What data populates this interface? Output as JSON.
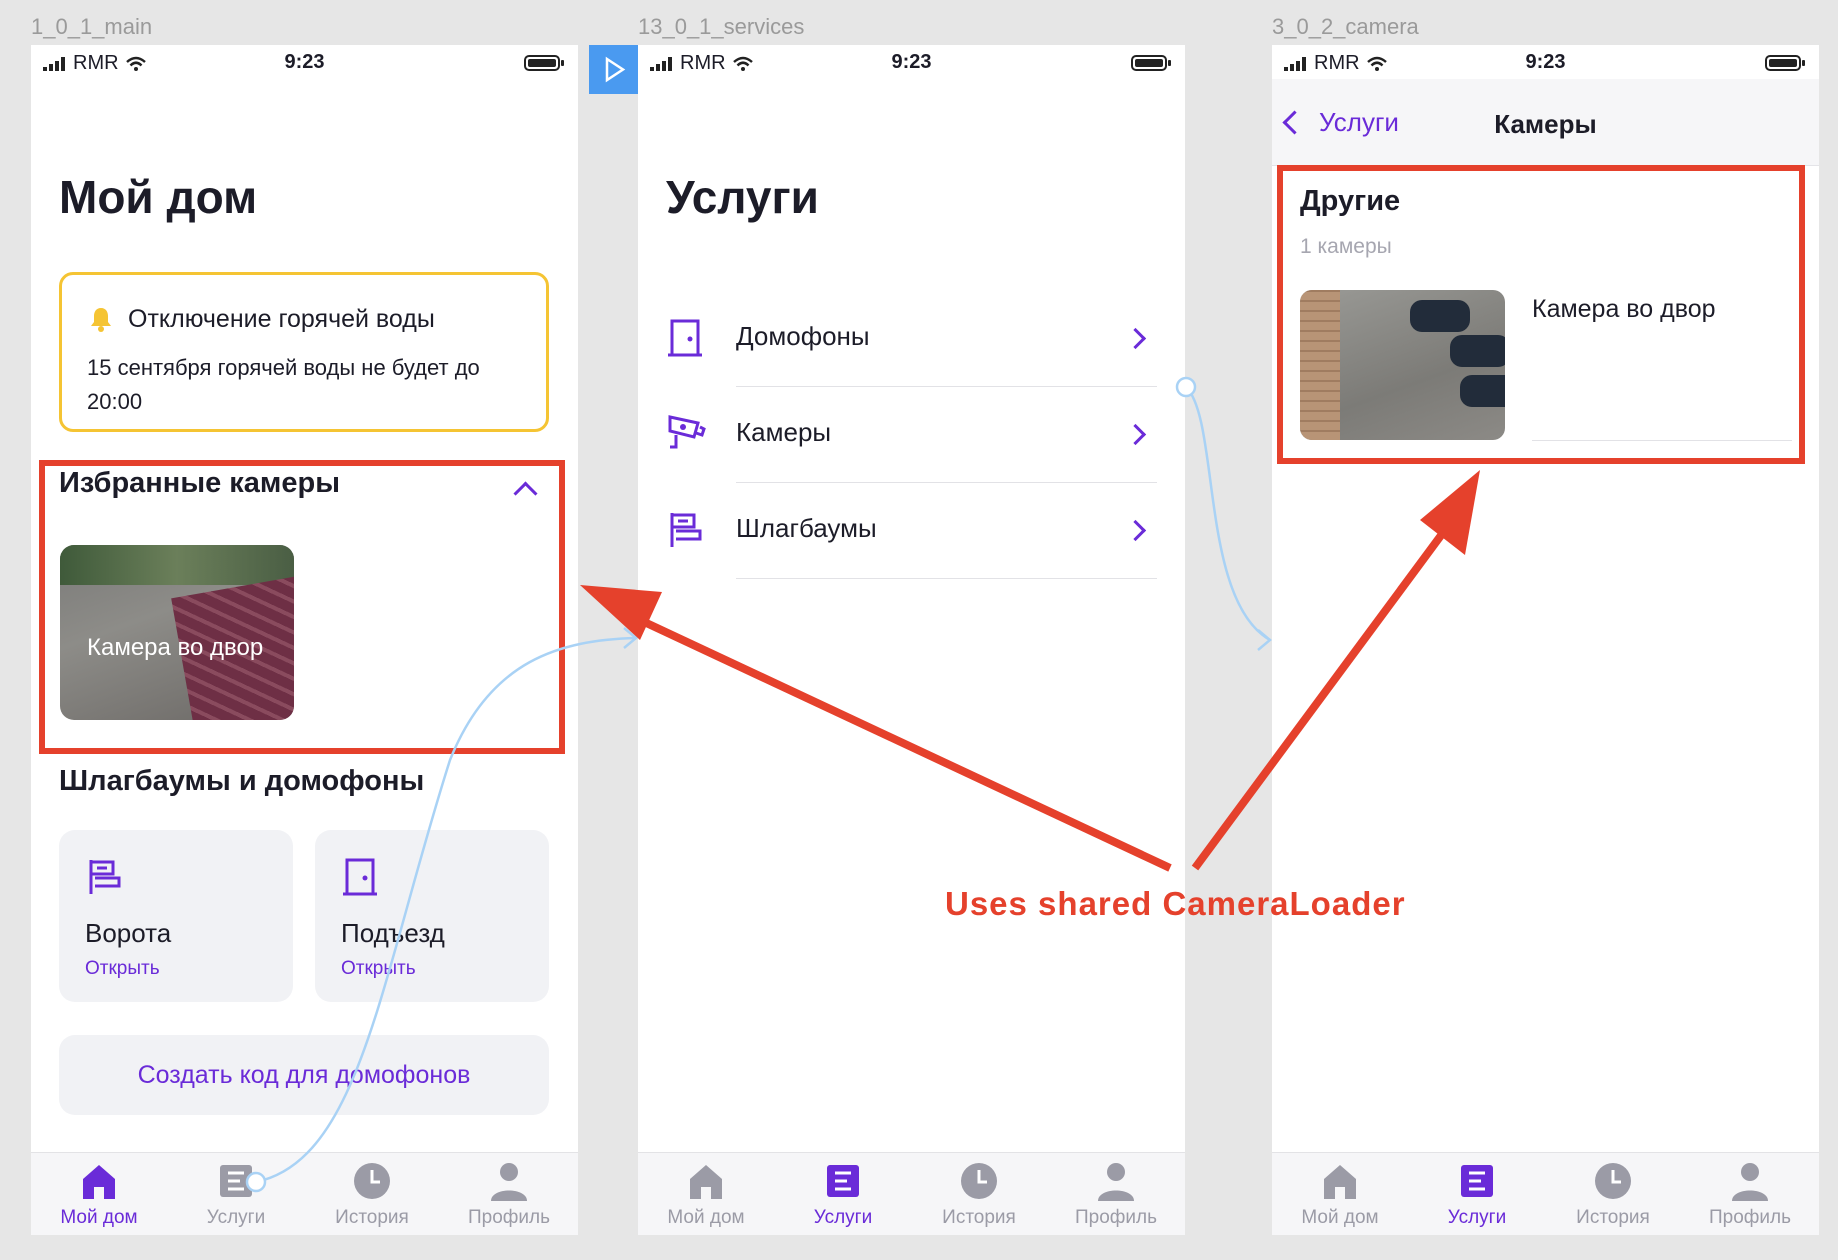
{
  "frames": {
    "main": {
      "label": "1_0_1_main",
      "status": {
        "carrier": "RMR",
        "time": "9:23"
      },
      "title": "Мой дом",
      "alert": {
        "title": "Отключение горячей воды",
        "text": "15 сентября горячей воды не будет до 20:00"
      },
      "favorites": {
        "title": "Избранные камеры",
        "camera_name": "Камера во двор"
      },
      "barriers": {
        "title": "Шлагбаумы и домофоны",
        "tiles": [
          {
            "title": "Ворота",
            "action": "Открыть",
            "icon": "barrier-icon"
          },
          {
            "title": "Подъезд",
            "action": "Открыть",
            "icon": "door-icon"
          }
        ]
      },
      "create_code_label": "Создать код для домофонов",
      "active_tab": 0
    },
    "services": {
      "label": "13_0_1_services",
      "status": {
        "carrier": "RMR",
        "time": "9:23"
      },
      "title": "Услуги",
      "items": [
        {
          "label": "Домофоны",
          "icon": "door-icon"
        },
        {
          "label": "Камеры",
          "icon": "camera-icon"
        },
        {
          "label": "Шлагбаумы",
          "icon": "barrier-icon"
        }
      ],
      "active_tab": 1
    },
    "camera": {
      "label": "3_0_2_camera",
      "status": {
        "carrier": "RMR",
        "time": "9:23"
      },
      "nav": {
        "back": "Услуги",
        "title": "Камеры"
      },
      "group": {
        "title": "Другие",
        "count": "1 камеры",
        "camera_name": "Камера во двор"
      },
      "active_tab": 1
    }
  },
  "tabs": [
    {
      "label": "Мой дом",
      "icon": "home-icon"
    },
    {
      "label": "Услуги",
      "icon": "services-icon"
    },
    {
      "label": "История",
      "icon": "clock-icon"
    },
    {
      "label": "Профиль",
      "icon": "profile-icon"
    }
  ],
  "annotation": {
    "caption": "Uses shared CameraLoader"
  },
  "colors": {
    "accent": "#6a2bd8",
    "highlight": "#e5412c",
    "alert_border": "#f5c433",
    "link_line": "#a9d2f5",
    "play_button": "#4a9af0"
  }
}
